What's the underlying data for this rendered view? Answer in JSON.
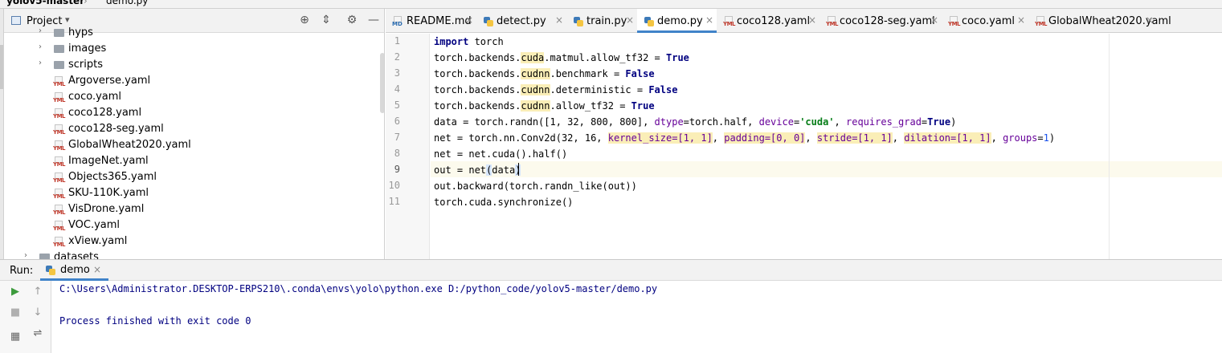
{
  "breadcrumb": {
    "project": "yolov5-master",
    "file": "demo.py"
  },
  "project_panel": {
    "title": "Project",
    "tree": [
      {
        "type": "folder",
        "name": "hyps",
        "depth": 2,
        "arrow": "›"
      },
      {
        "type": "folder",
        "name": "images",
        "depth": 2,
        "arrow": "›"
      },
      {
        "type": "folder",
        "name": "scripts",
        "depth": 2,
        "arrow": "›"
      },
      {
        "type": "yaml",
        "name": "Argoverse.yaml",
        "depth": 2
      },
      {
        "type": "yaml",
        "name": "coco.yaml",
        "depth": 2
      },
      {
        "type": "yaml",
        "name": "coco128.yaml",
        "depth": 2
      },
      {
        "type": "yaml",
        "name": "coco128-seg.yaml",
        "depth": 2
      },
      {
        "type": "yaml",
        "name": "GlobalWheat2020.yaml",
        "depth": 2
      },
      {
        "type": "yaml",
        "name": "ImageNet.yaml",
        "depth": 2
      },
      {
        "type": "yaml",
        "name": "Objects365.yaml",
        "depth": 2
      },
      {
        "type": "yaml",
        "name": "SKU-110K.yaml",
        "depth": 2
      },
      {
        "type": "yaml",
        "name": "VisDrone.yaml",
        "depth": 2
      },
      {
        "type": "yaml",
        "name": "VOC.yaml",
        "depth": 2
      },
      {
        "type": "yaml",
        "name": "xView.yaml",
        "depth": 2
      },
      {
        "type": "folder",
        "name": "datasets",
        "depth": 1,
        "arrow": "›"
      }
    ]
  },
  "tabs": [
    {
      "label": "README.md",
      "icon": "md",
      "active": false
    },
    {
      "label": "detect.py",
      "icon": "py",
      "active": false
    },
    {
      "label": "train.py",
      "icon": "py",
      "active": false
    },
    {
      "label": "demo.py",
      "icon": "py",
      "active": true
    },
    {
      "label": "coco128.yaml",
      "icon": "yaml",
      "active": false
    },
    {
      "label": "coco128-seg.yaml",
      "icon": "yaml",
      "active": false
    },
    {
      "label": "coco.yaml",
      "icon": "yaml",
      "active": false
    },
    {
      "label": "GlobalWheat2020.yaml",
      "icon": "yaml",
      "active": false
    }
  ],
  "editor": {
    "current_line": 9,
    "lines": [
      [
        {
          "t": "import",
          "c": "kw"
        },
        {
          "t": " torch"
        }
      ],
      [
        {
          "t": "torch.backends."
        },
        {
          "t": "cuda",
          "c": "hl"
        },
        {
          "t": ".matmul.allow_tf32 = "
        },
        {
          "t": "True",
          "c": "kw"
        }
      ],
      [
        {
          "t": "torch.backends."
        },
        {
          "t": "cudnn",
          "c": "hl"
        },
        {
          "t": ".benchmark = "
        },
        {
          "t": "False",
          "c": "kw"
        }
      ],
      [
        {
          "t": "torch.backends."
        },
        {
          "t": "cudnn",
          "c": "hl"
        },
        {
          "t": ".deterministic = "
        },
        {
          "t": "False",
          "c": "kw"
        }
      ],
      [
        {
          "t": "torch.backends."
        },
        {
          "t": "cudnn",
          "c": "hl"
        },
        {
          "t": ".allow_tf32 = "
        },
        {
          "t": "True",
          "c": "kw"
        }
      ],
      [
        {
          "t": "data = torch.randn([1, 32, 800, 800], "
        },
        {
          "t": "dtype",
          "c": "param"
        },
        {
          "t": "=torch.half, "
        },
        {
          "t": "device",
          "c": "param"
        },
        {
          "t": "="
        },
        {
          "t": "'cuda'",
          "c": "str"
        },
        {
          "t": ", "
        },
        {
          "t": "requires_grad",
          "c": "param"
        },
        {
          "t": "="
        },
        {
          "t": "True",
          "c": "kw"
        },
        {
          "t": ")"
        }
      ],
      [
        {
          "t": "net = torch.nn.Conv2d(32, 16, "
        },
        {
          "t": "kernel_size=[1, 1]",
          "c": "param hl"
        },
        {
          "t": ", "
        },
        {
          "t": "padding=[0, 0]",
          "c": "param hl"
        },
        {
          "t": ", "
        },
        {
          "t": "stride=[1, 1]",
          "c": "param hl"
        },
        {
          "t": ", "
        },
        {
          "t": "dilation=[1, 1]",
          "c": "param hl"
        },
        {
          "t": ", "
        },
        {
          "t": "groups",
          "c": "param"
        },
        {
          "t": "="
        },
        {
          "t": "1",
          "c": "num"
        },
        {
          "t": ")"
        }
      ],
      [
        {
          "t": "net = net.cuda().half()"
        }
      ],
      [
        {
          "t": "out = net"
        },
        {
          "t": "(",
          "c": "bracket"
        },
        {
          "t": "data"
        },
        {
          "t": ")",
          "c": "bracket"
        }
      ],
      [
        {
          "t": "out.backward(torch.randn_like(out))"
        }
      ],
      [
        {
          "t": "torch.cuda.synchronize()"
        }
      ]
    ]
  },
  "run_panel": {
    "label": "Run:",
    "tab": "demo",
    "console": [
      "C:\\Users\\Administrator.DESKTOP-ERPS210\\.conda\\envs\\yolo\\python.exe D:/python_code/yolov5-master/demo.py",
      "",
      "Process finished with exit code 0"
    ]
  }
}
